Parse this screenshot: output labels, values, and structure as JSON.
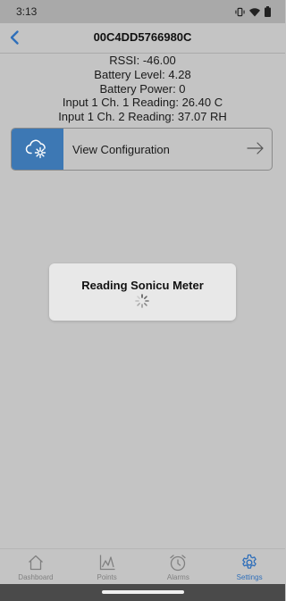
{
  "status_bar": {
    "time": "3:13",
    "icons": [
      "vibrate-icon",
      "wifi-icon",
      "battery-icon"
    ]
  },
  "header": {
    "title": "00C4DD5766980C",
    "back_icon": "chevron-left-icon"
  },
  "info": {
    "rssi": "RSSI: -46.00",
    "battery_level": "Battery Level: 4.28",
    "battery_power": "Battery Power: 0",
    "input1_ch1": "Input 1 Ch. 1 Reading: 26.40 C",
    "input1_ch2": "Input 1 Ch. 2 Reading: 37.07 RH"
  },
  "config_button": {
    "label": "View Configuration",
    "icon": "cloud-gear-icon",
    "arrow_icon": "arrow-right-icon"
  },
  "dialog": {
    "message": "Reading Sonicu Meter",
    "icon": "spinner-icon"
  },
  "tabs": [
    {
      "label": "Dashboard",
      "icon": "home-icon",
      "active": false
    },
    {
      "label": "Points",
      "icon": "chart-icon",
      "active": false
    },
    {
      "label": "Alarms",
      "icon": "alarm-clock-icon",
      "active": false
    },
    {
      "label": "Settings",
      "icon": "gear-icon",
      "active": true
    }
  ],
  "colors": {
    "accent": "#3d78b4",
    "active_tab": "#2f6fba",
    "background": "#c4c4c4"
  }
}
